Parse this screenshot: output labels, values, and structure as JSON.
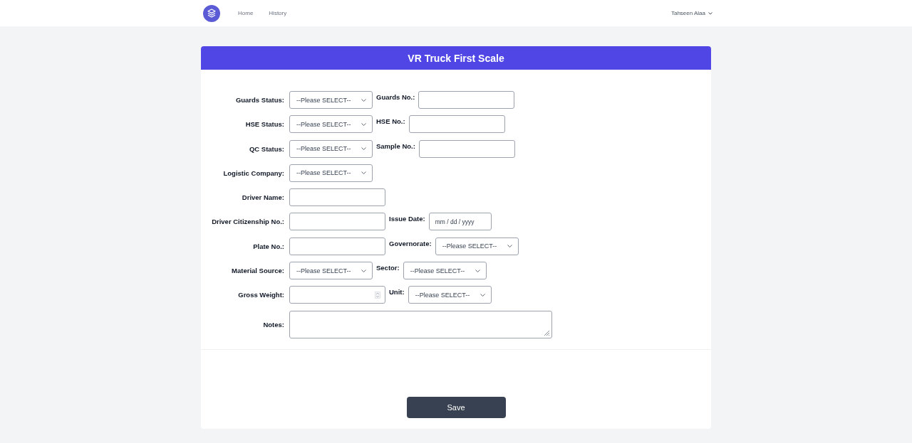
{
  "nav": {
    "links": [
      {
        "label": "Home",
        "selected": false
      },
      {
        "label": "History",
        "selected": false
      }
    ],
    "user": "Tahseen Alaa"
  },
  "form": {
    "title": "VR Truck First Scale",
    "rows": [
      {
        "label": "Guards Status:",
        "field": {
          "kind": "select",
          "value": "--Please SELECT--"
        },
        "extra": {
          "label": "Guards No.:",
          "field": {
            "kind": "text"
          }
        }
      },
      {
        "label": "HSE Status:",
        "field": {
          "kind": "select",
          "value": "--Please SELECT--"
        },
        "extra": {
          "label": "HSE No.:",
          "field": {
            "kind": "text"
          }
        }
      },
      {
        "label": "QC Status:",
        "field": {
          "kind": "select",
          "value": "--Please SELECT--"
        },
        "extra": {
          "label": "Sample No.:",
          "field": {
            "kind": "text"
          }
        }
      },
      {
        "label": "Logistic Company:",
        "field": {
          "kind": "select",
          "value": "--Please SELECT--"
        }
      },
      {
        "label": "Driver Name:",
        "field": {
          "kind": "text"
        }
      },
      {
        "label": "Driver Citizenship No.:",
        "field": {
          "kind": "text"
        },
        "extra": {
          "label": "Issue Date:",
          "field": {
            "kind": "date",
            "placeholder": "mm / dd / yyyy"
          }
        }
      },
      {
        "label": "Plate No.:",
        "field": {
          "kind": "text"
        },
        "extra": {
          "label": "Governorate:",
          "field": {
            "kind": "select",
            "value": "--Please SELECT--"
          }
        }
      },
      {
        "label": "Material Source:",
        "field": {
          "kind": "select",
          "value": "--Please SELECT--"
        },
        "extra": {
          "label": "Sector:",
          "field": {
            "kind": "select",
            "value": "--Please SELECT--"
          }
        }
      },
      {
        "label": "Gross Weight:",
        "field": {
          "kind": "number"
        },
        "extra": {
          "label": "Unit:",
          "field": {
            "kind": "select",
            "value": "--Please SELECT--"
          }
        }
      },
      {
        "label": "Notes:",
        "field": {
          "kind": "textarea"
        }
      }
    ],
    "save_button": "Save"
  }
}
